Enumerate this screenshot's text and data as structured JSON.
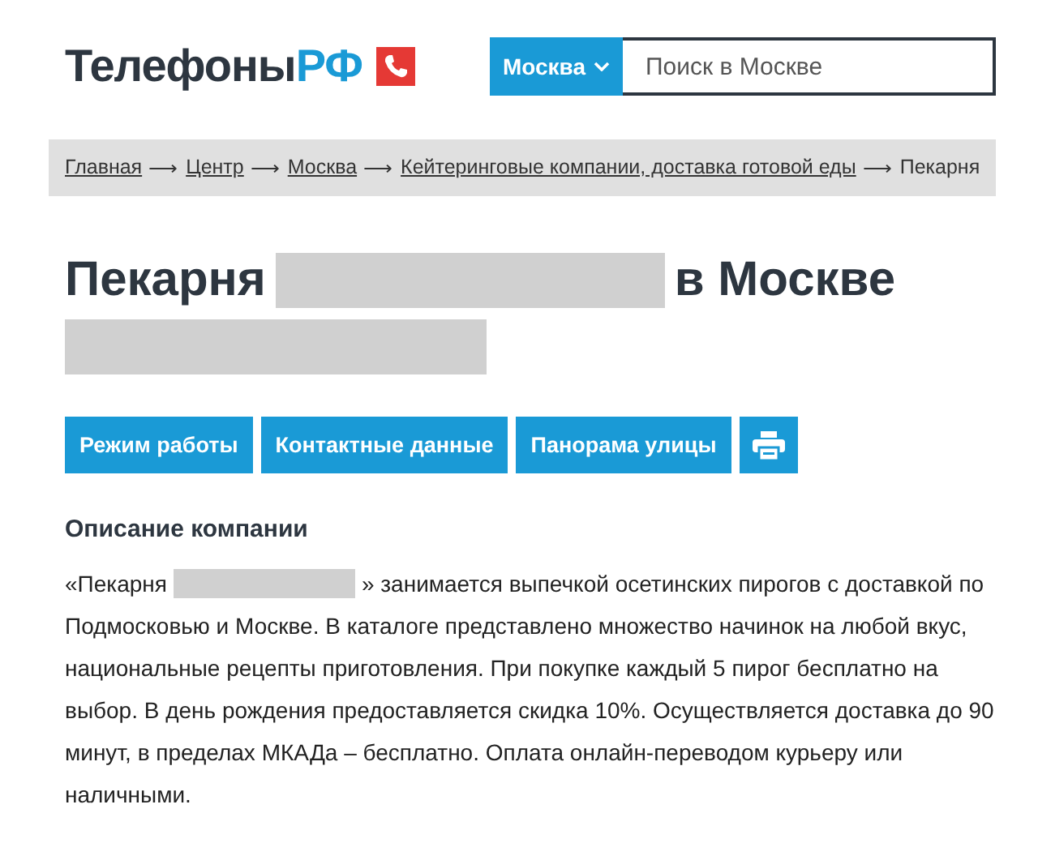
{
  "header": {
    "logo": {
      "dark": "Телефоны",
      "accent": "РФ"
    },
    "city_button": "Москва",
    "search": {
      "placeholder": "Поиск в Москве"
    }
  },
  "breadcrumbs": [
    {
      "label": "Главная",
      "link": true
    },
    {
      "label": "Центр",
      "link": true
    },
    {
      "label": "Москва",
      "link": true
    },
    {
      "label": "Кейтеринговые компании, доставка готовой еды",
      "link": true
    },
    {
      "label": "Пекарня",
      "link": false
    }
  ],
  "breadcrumb_separator": "⟶",
  "title": [
    {
      "kind": "text",
      "text": "Пекарня"
    },
    {
      "kind": "redacted"
    },
    {
      "kind": "text",
      "text": "в Москве"
    },
    {
      "kind": "break"
    },
    {
      "kind": "redacted"
    }
  ],
  "buttons": [
    {
      "kind": "text",
      "label": "Режим работы"
    },
    {
      "kind": "text",
      "label": "Контактные данные"
    },
    {
      "kind": "text",
      "label": "Панорама улицы"
    },
    {
      "kind": "print"
    }
  ],
  "description": {
    "heading": "Описание компании",
    "paragraph": [
      {
        "kind": "text",
        "text": "«Пекарня"
      },
      {
        "kind": "redacted"
      },
      {
        "kind": "text",
        "text": "» занимается выпечкой осетинских пирогов с доставкой по"
      },
      {
        "kind": "block",
        "text": "Подмосковью и Москве. В каталоге представлено множество начинок на любой вкус, национальные рецепты приготовления. При покупке каждый 5 пирог бесплатно на выбор. В день рождения предоставляется скидка 10%. Осуществляется доставка до 90 минут, в пределах МКАДа – бесплатно. Оплата онлайн-переводом курьеру или наличными."
      }
    ]
  }
}
